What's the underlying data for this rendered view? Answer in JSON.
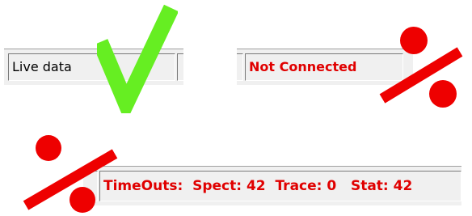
{
  "status_panels": {
    "live": {
      "text": "Live data",
      "state": "ok",
      "text_color": "#000000"
    },
    "not_connected": {
      "text": "Not Connected",
      "state": "error",
      "text_color": "#e00000"
    },
    "timeouts": {
      "text": "TimeOuts:  Spect: 42  Trace: 0   Stat: 42",
      "state": "error",
      "text_color": "#e00000"
    }
  },
  "overlays": {
    "checkmark": {
      "icon": "checkmark-icon",
      "color": "#66ee22"
    },
    "fail_marks": {
      "icon": "percent-icon",
      "color": "#ee0000"
    }
  }
}
